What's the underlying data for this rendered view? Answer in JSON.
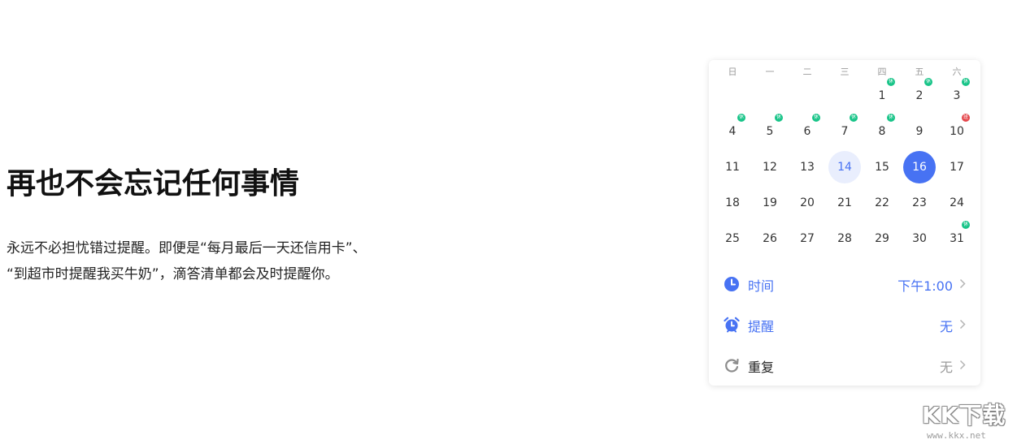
{
  "hero": {
    "title": "再也不会忘记任何事情",
    "description_line1": "永远不必担忧错过提醒。即便是“每月最后一天还信用卡”、",
    "description_line2": "“到超市时提醒我买牛奶”，滴答清单都会及时提醒你。"
  },
  "calendar": {
    "weekdays": [
      "日",
      "一",
      "二",
      "三",
      "四",
      "五",
      "六"
    ],
    "days": [
      {
        "label": "1",
        "tag": "休"
      },
      {
        "label": "2",
        "tag": "休"
      },
      {
        "label": "3",
        "tag": "休"
      },
      {
        "label": "4",
        "tag": "休"
      },
      {
        "label": "5",
        "tag": "休"
      },
      {
        "label": "6",
        "tag": "休"
      },
      {
        "label": "7",
        "tag": "休"
      },
      {
        "label": "8",
        "tag": "休"
      },
      {
        "label": "9"
      },
      {
        "label": "10",
        "tag": "班"
      },
      {
        "label": "11"
      },
      {
        "label": "12"
      },
      {
        "label": "13"
      },
      {
        "label": "14",
        "state": "today"
      },
      {
        "label": "15"
      },
      {
        "label": "16",
        "state": "selected"
      },
      {
        "label": "17"
      },
      {
        "label": "18"
      },
      {
        "label": "19"
      },
      {
        "label": "20"
      },
      {
        "label": "21"
      },
      {
        "label": "22"
      },
      {
        "label": "23"
      },
      {
        "label": "24"
      },
      {
        "label": "25"
      },
      {
        "label": "26"
      },
      {
        "label": "27"
      },
      {
        "label": "28"
      },
      {
        "label": "29"
      },
      {
        "label": "30"
      },
      {
        "label": "31",
        "tag": "休"
      }
    ],
    "first_weekday_index": 4
  },
  "settings": {
    "time": {
      "label": "时间",
      "value": "下午1:00",
      "icon": "clock-icon"
    },
    "reminder": {
      "label": "提醒",
      "value": "无",
      "icon": "alarm-clock-icon"
    },
    "repeat": {
      "label": "重复",
      "value": "无",
      "icon": "repeat-icon"
    }
  },
  "colors": {
    "accent": "#4772f3",
    "today_bg": "#e9eefd",
    "rest_tag": "#18c488",
    "work_tag": "#e5484d"
  },
  "watermark": {
    "brand": "KK下载",
    "url": "www.kkx.net"
  }
}
